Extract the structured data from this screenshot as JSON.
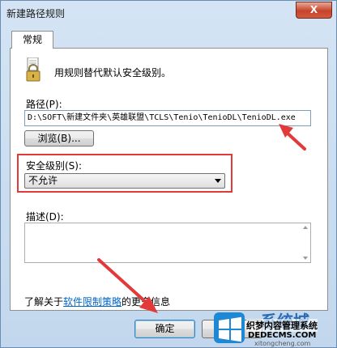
{
  "window": {
    "title": "新建路径规则",
    "close_label": "X"
  },
  "tabs": [
    {
      "label": "常规",
      "selected": true
    }
  ],
  "header": {
    "description": "用规则替代默认安全级别。"
  },
  "path": {
    "label": "路径(P):",
    "value": "D:\\SOFT\\新建文件夹\\英雄联盟\\TCLS\\Tenio\\TenioDL\\TenioDL.exe",
    "browse_label": "浏览(B)..."
  },
  "security_level": {
    "label": "安全级别(S):",
    "selected": "不允许"
  },
  "description_field": {
    "label": "描述(D):",
    "value": ""
  },
  "learn_more": {
    "prefix": "了解关于",
    "link": "软件限制策略",
    "suffix": "的更多信息"
  },
  "buttons": {
    "ok": "确定",
    "cancel": "消"
  },
  "watermark": {
    "top": "系统城",
    "middle": "织梦内容管理系统",
    "site": "DEDECMS.COM",
    "url": "xitongcheng.com"
  },
  "colors": {
    "annotation_red": "#e23a3a",
    "link": "#0066cc",
    "title_bar": "#c9dcef"
  }
}
